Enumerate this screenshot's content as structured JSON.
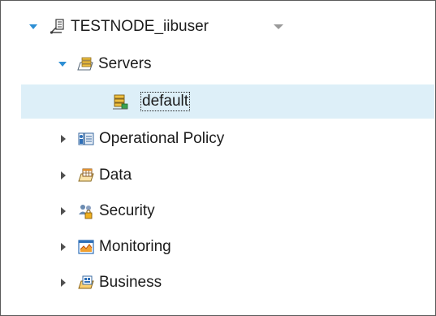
{
  "tree": {
    "root": {
      "label": "TESTNODE_iibuser",
      "icon": "integration-node-icon",
      "expanded": true
    },
    "servers": {
      "label": "Servers",
      "icon": "servers-folder-icon",
      "expanded": true
    },
    "default_server": {
      "label": "default",
      "icon": "integration-server-icon",
      "selected": true
    },
    "operational_policy": {
      "label": "Operational Policy",
      "icon": "operational-policy-icon",
      "expanded": false
    },
    "data": {
      "label": "Data",
      "icon": "data-icon",
      "expanded": false
    },
    "security": {
      "label": "Security",
      "icon": "security-icon",
      "expanded": false
    },
    "monitoring": {
      "label": "Monitoring",
      "icon": "monitoring-icon",
      "expanded": false
    },
    "business": {
      "label": "Business",
      "icon": "business-icon",
      "expanded": false
    }
  },
  "colors": {
    "selection_bg": "#ddeff8",
    "expand_arrow": "#2e8fd4",
    "collapse_arrow": "#505050",
    "frame_border": "#5a5a5a"
  }
}
